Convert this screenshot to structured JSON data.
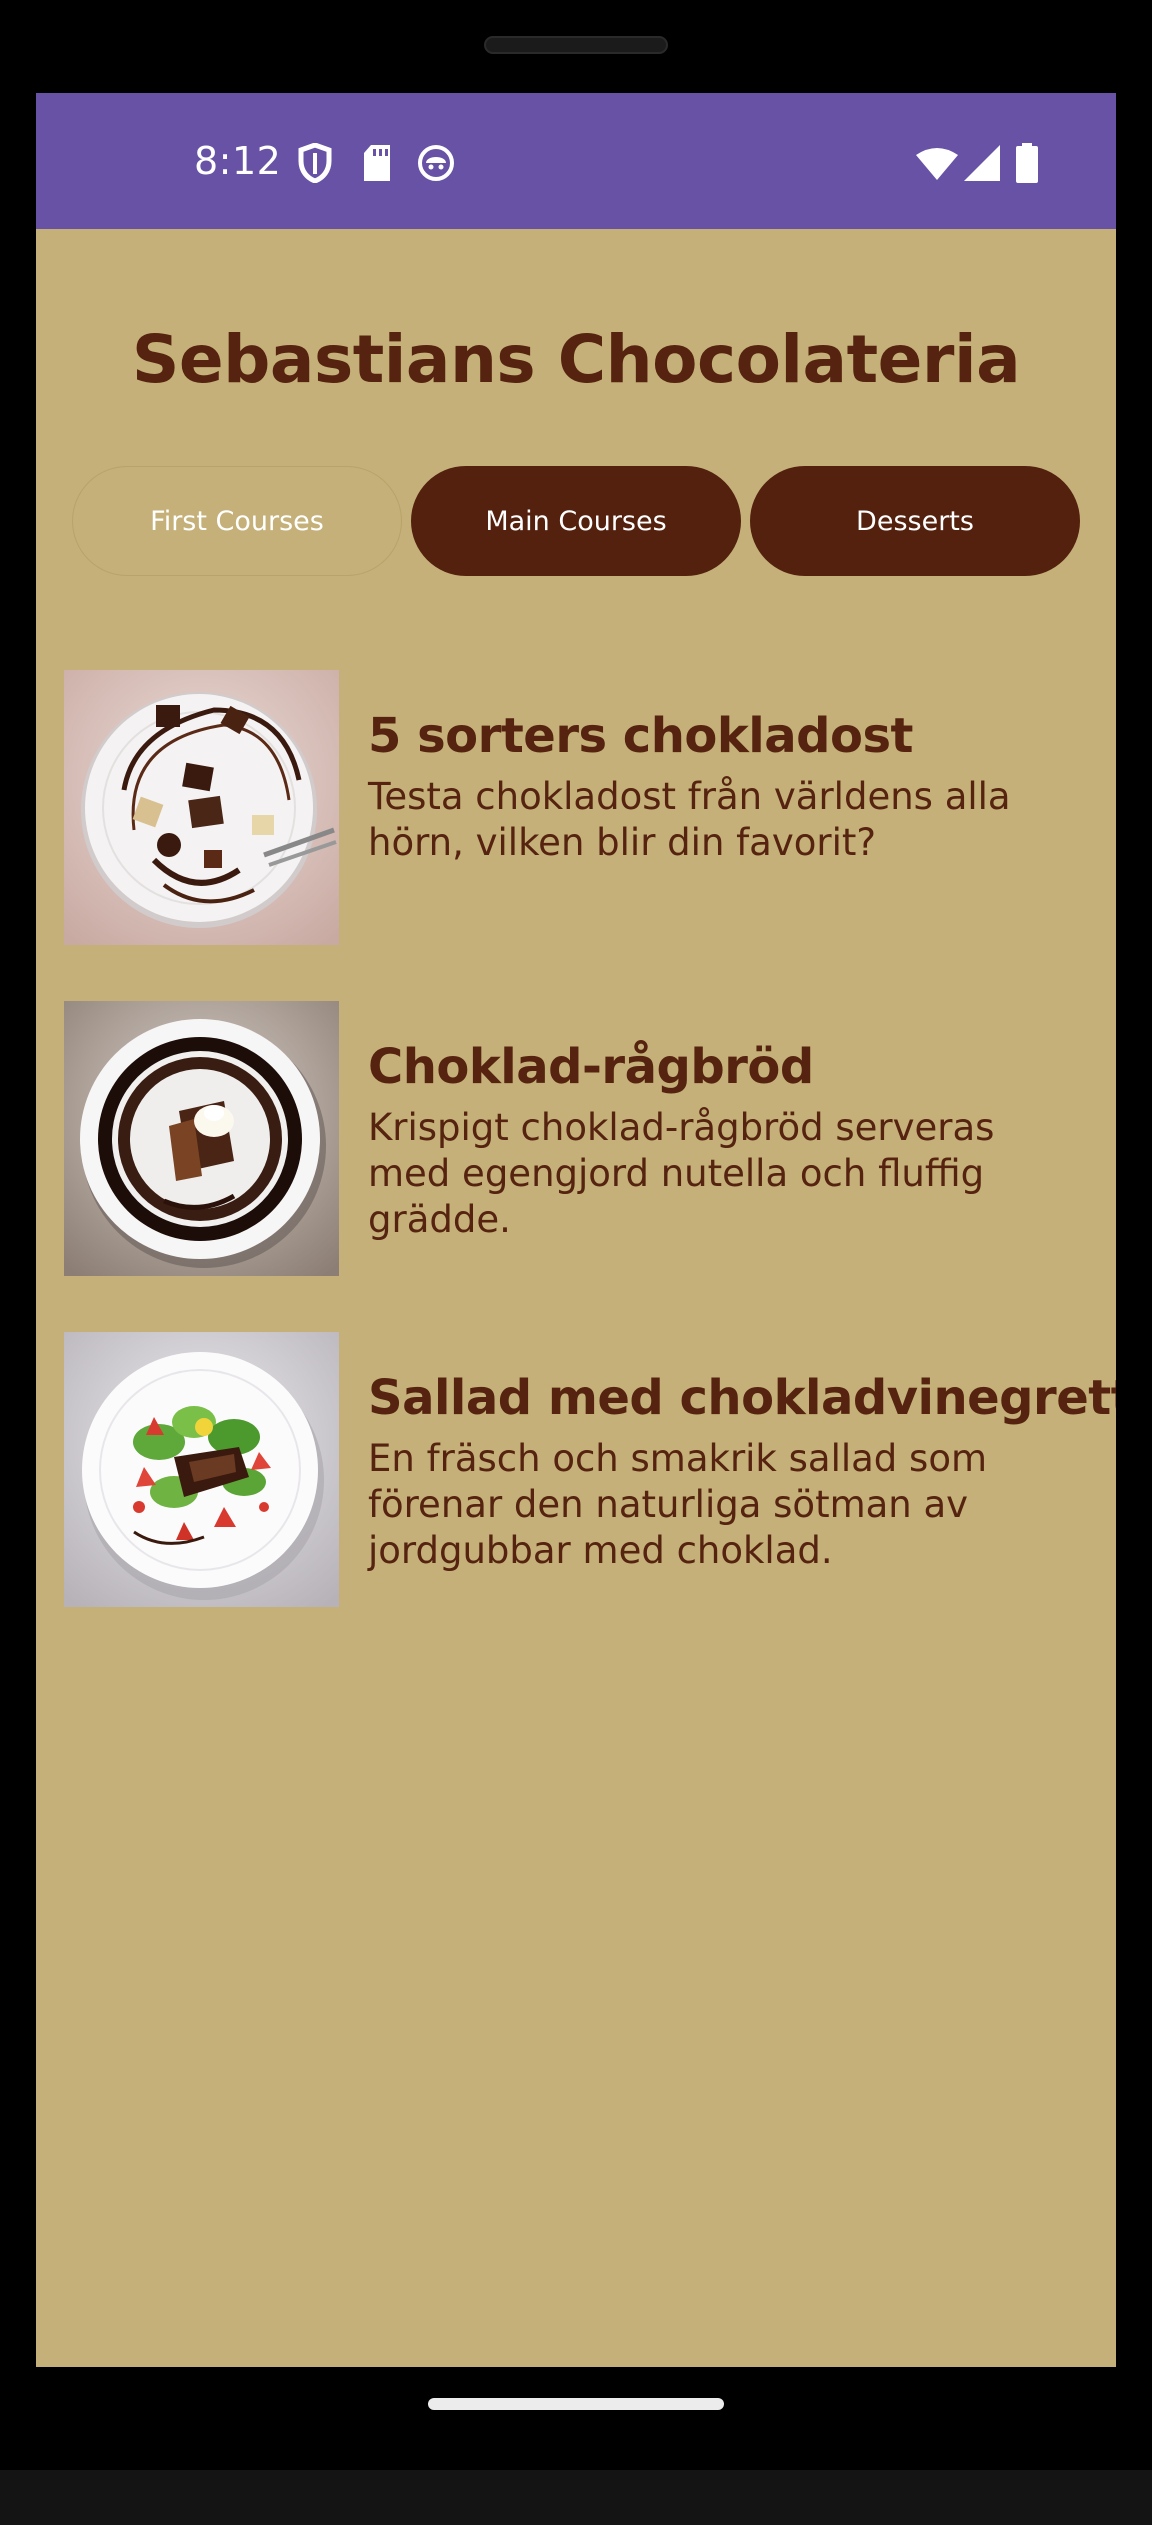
{
  "status_bar": {
    "time": "8:12",
    "left_icons": [
      "shield-icon",
      "sd-card-icon",
      "face-icon"
    ],
    "right_icons": [
      "wifi-icon",
      "signal-icon",
      "battery-icon"
    ],
    "color": "#6852a6"
  },
  "app": {
    "title": "Sebastians Chocolateria",
    "background": "#c4b078",
    "accent": "#53210e"
  },
  "tabs": [
    {
      "label": "First Courses",
      "selected": true
    },
    {
      "label": "Main Courses",
      "selected": false
    },
    {
      "label": "Desserts",
      "selected": false
    }
  ],
  "menu": {
    "items": [
      {
        "title": "5 sorters chokladost",
        "description": "Testa chokladost från världens alla hörn, vilken blir din favorit?",
        "image": "plate-with-chocolate-cheese-pieces"
      },
      {
        "title": "Choklad-rågbröd",
        "description": "Krispigt choklad-rågbröd serveras med egengjord nutella och fluffig grädde.",
        "image": "plate-with-rye-bread-and-cream"
      },
      {
        "title": "Sallad med chokladvinegrette",
        "description": "En fräsch och smakrik sallad som förenar den naturliga sötman av jordgubbar med choklad.",
        "image": "plate-with-strawberry-salad"
      }
    ]
  }
}
